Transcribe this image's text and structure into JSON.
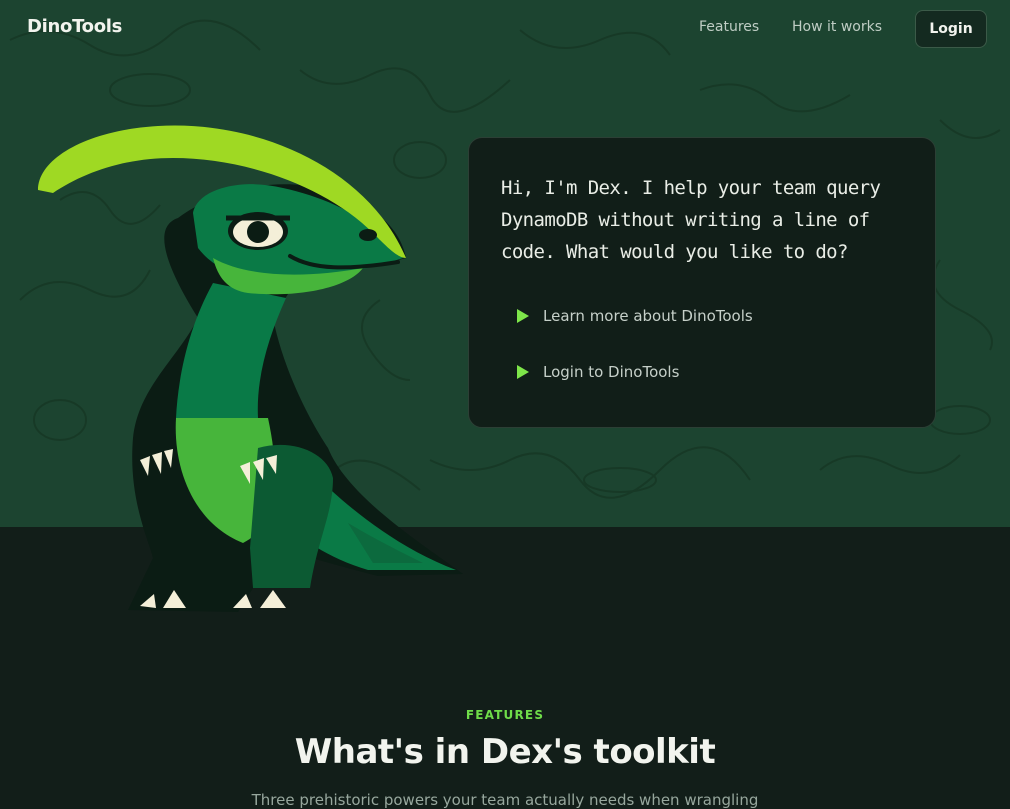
{
  "nav": {
    "brand": "DinoTools",
    "links": [
      "Features",
      "How it works"
    ],
    "login_label": "Login"
  },
  "hero": {
    "message": "Hi, I'm Dex. I help your team query DynamoDB without writing a line of code. What would you like to do?",
    "options": [
      "Learn more about DinoTools",
      "Login to DinoTools"
    ]
  },
  "features": {
    "eyebrow": "FEATURES",
    "title": "What's in Dex's toolkit",
    "subtitle": "Three prehistoric powers your team actually needs when wrangling"
  },
  "colors": {
    "hero_bg": "#1c4430",
    "page_bg": "#121e19",
    "accent": "#7ee64a",
    "card_bg": "#111e18"
  },
  "icons": {
    "option_icon": "play-triangle-icon",
    "mascot": "dino-mascot-illustration"
  }
}
